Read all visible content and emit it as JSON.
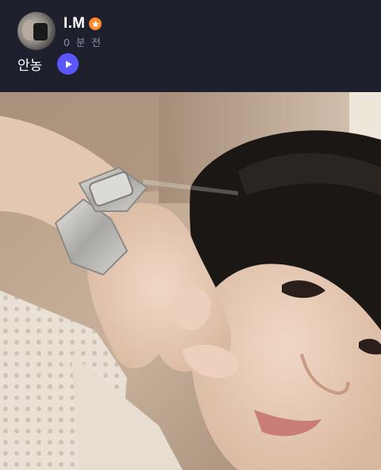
{
  "post": {
    "author_name": "I.M",
    "timestamp": "0 분 전",
    "message": "안농"
  },
  "icons": {
    "badge": "orange-star-badge-icon",
    "play": "play-icon"
  },
  "colors": {
    "background": "#1e202d",
    "badge": "#ff8a2b",
    "play_button": "#5b57ff",
    "time_text": "#8a8fa3"
  }
}
